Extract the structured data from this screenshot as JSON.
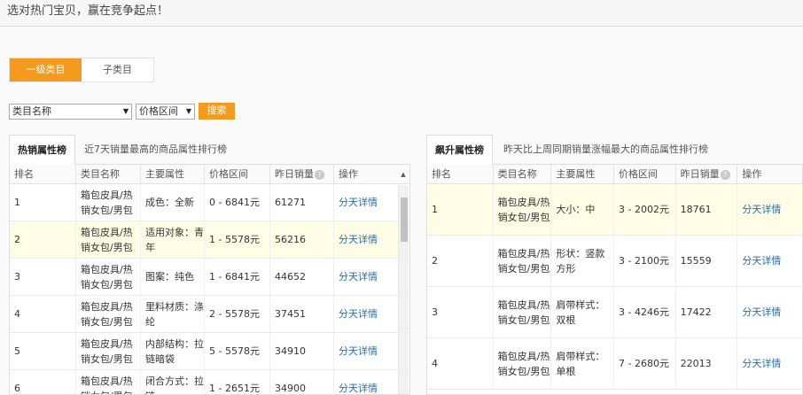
{
  "banner": {
    "text": "选对热门宝贝，赢在竞争起点！"
  },
  "tabs": [
    {
      "label": "一级类目",
      "active": true
    },
    {
      "label": "子类目",
      "active": false
    }
  ],
  "filters": {
    "category_select": "类目名称",
    "price_select": "价格区间",
    "search_button": "搜索"
  },
  "left_panel": {
    "tab_label": "热销属性榜",
    "description": "近7天销量最高的商品属性排行榜",
    "columns": [
      "排名",
      "类目名称",
      "主要属性",
      "价格区间",
      "昨日销量",
      "操作"
    ],
    "rows": [
      {
        "rank": "1",
        "category": "箱包皮具/热销女包/男包",
        "attribute": "成色：全新",
        "price": "0 - 6841元",
        "sales": "61271",
        "action": "分天详情",
        "highlight": false
      },
      {
        "rank": "2",
        "category": "箱包皮具/热销女包/男包",
        "attribute": "适用对象：青年",
        "price": "1 - 5578元",
        "sales": "56216",
        "action": "分天详情",
        "highlight": true
      },
      {
        "rank": "3",
        "category": "箱包皮具/热销女包/男包",
        "attribute": "图案：纯色",
        "price": "1 - 6841元",
        "sales": "44652",
        "action": "分天详情",
        "highlight": false
      },
      {
        "rank": "4",
        "category": "箱包皮具/热销女包/男包",
        "attribute": "里料材质：涤纶",
        "price": "2 - 5578元",
        "sales": "37451",
        "action": "分天详情",
        "highlight": false
      },
      {
        "rank": "5",
        "category": "箱包皮具/热销女包/男包",
        "attribute": "内部结构：拉链暗袋",
        "price": "5 - 5578元",
        "sales": "34910",
        "action": "分天详情",
        "highlight": false
      },
      {
        "rank": "6",
        "category": "箱包皮具/热销女包/男包",
        "attribute": "闭合方式：拉链",
        "price": "1 - 2651元",
        "sales": "34900",
        "action": "分天详情",
        "highlight": false
      }
    ]
  },
  "right_panel": {
    "tab_label": "飙升属性榜",
    "description": "昨天比上周同期销量涨幅最大的商品属性排行榜",
    "columns": [
      "排名",
      "类目名称",
      "主要属性",
      "价格区间",
      "昨日销量",
      "操作"
    ],
    "rows": [
      {
        "rank": "1",
        "category": "箱包皮具/热销女包/男包",
        "attribute": "大小：中",
        "price": "3 - 2002元",
        "sales": "18761",
        "action": "分天详情",
        "highlight": true
      },
      {
        "rank": "2",
        "category": "箱包皮具/热销女包/男包",
        "attribute": "形状：竖款方形",
        "price": "3 - 2100元",
        "sales": "15559",
        "action": "分天详情",
        "highlight": false
      },
      {
        "rank": "3",
        "category": "箱包皮具/热销女包/男包",
        "attribute": "肩带样式：双根",
        "price": "3 - 4246元",
        "sales": "17422",
        "action": "分天详情",
        "highlight": false
      },
      {
        "rank": "4",
        "category": "箱包皮具/热销女包/男包",
        "attribute": "肩带样式：单根",
        "price": "7 - 2680元",
        "sales": "22013",
        "action": "分天详情",
        "highlight": false
      }
    ]
  },
  "colors": {
    "accent": "#f39a1f",
    "link": "#1d6fbd",
    "highlight_row": "#fffde6"
  }
}
